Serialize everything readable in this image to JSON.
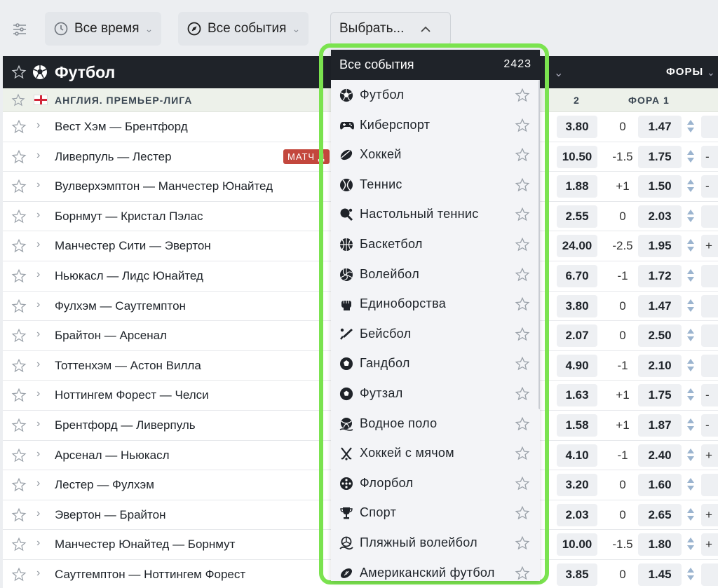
{
  "filters": {
    "time_label": "Все время",
    "events_label": "Все события",
    "select_label": "Выбрать..."
  },
  "sport_header": {
    "title": "Футбол",
    "fory_label": "ФОРЫ"
  },
  "league": {
    "name": "АНГЛИЯ. ПРЕМЬЕР-ЛИГА",
    "col_2": "2",
    "col_fora1": "ФОРА 1"
  },
  "matches": [
    {
      "teams": "Вест Хэм — Брентфорд",
      "odd2": "3.80",
      "handicap": "0",
      "fora1": "1.47",
      "edge": ""
    },
    {
      "teams": "Ливерпуль — Лестер",
      "badge": "МАТЧ Д",
      "odd2": "10.50",
      "handicap": "-1.5",
      "fora1": "1.75",
      "edge": "-"
    },
    {
      "teams": "Вулверхэмптон — Манчестер Юнайтед",
      "odd2": "1.88",
      "handicap": "+1",
      "fora1": "1.50",
      "edge": "-"
    },
    {
      "teams": "Борнмут — Кристал Пэлас",
      "odd2": "2.55",
      "handicap": "0",
      "fora1": "2.03",
      "edge": ""
    },
    {
      "teams": "Манчестер Сити — Эвертон",
      "odd2": "24.00",
      "handicap": "-2.5",
      "fora1": "1.95",
      "edge": "+"
    },
    {
      "teams": "Ньюкасл — Лидс Юнайтед",
      "odd2": "6.70",
      "handicap": "-1",
      "fora1": "1.72",
      "edge": ""
    },
    {
      "teams": "Фулхэм — Саутгемптон",
      "odd2": "3.80",
      "handicap": "0",
      "fora1": "1.47",
      "edge": ""
    },
    {
      "teams": "Брайтон — Арсенал",
      "odd2": "2.07",
      "handicap": "0",
      "fora1": "2.50",
      "edge": ""
    },
    {
      "teams": "Тоттенхэм — Астон Вилла",
      "odd2": "4.90",
      "handicap": "-1",
      "fora1": "2.10",
      "edge": ""
    },
    {
      "teams": "Ноттингем Форест — Челси",
      "odd2": "1.63",
      "handicap": "+1",
      "fora1": "1.75",
      "edge": "-"
    },
    {
      "teams": "Брентфорд — Ливерпуль",
      "odd2": "1.58",
      "handicap": "+1",
      "fora1": "1.87",
      "edge": "-"
    },
    {
      "teams": "Арсенал — Ньюкасл",
      "odd2": "4.10",
      "handicap": "-1",
      "fora1": "2.40",
      "edge": "+"
    },
    {
      "teams": "Лестер — Фулхэм",
      "odd2": "3.20",
      "handicap": "0",
      "fora1": "1.60",
      "edge": ""
    },
    {
      "teams": "Эвертон — Брайтон",
      "odd2": "2.03",
      "handicap": "0",
      "fora1": "2.65",
      "edge": "+"
    },
    {
      "teams": "Манчестер Юнайтед — Борнмут",
      "odd2": "10.00",
      "handicap": "-1.5",
      "fora1": "1.80",
      "edge": "+"
    },
    {
      "teams": "Саутгемптон — Ноттингем Форест",
      "odd2": "3.85",
      "handicap": "0",
      "fora1": "1.45",
      "edge": ""
    }
  ],
  "dropdown": {
    "header_label": "Все события",
    "header_count": "2423",
    "items": [
      {
        "label": "Футбол",
        "icon": "soccer-ball-icon"
      },
      {
        "label": "Киберспорт",
        "icon": "gamepad-icon"
      },
      {
        "label": "Хоккей",
        "icon": "hockey-puck-icon"
      },
      {
        "label": "Теннис",
        "icon": "tennis-ball-icon"
      },
      {
        "label": "Настольный теннис",
        "icon": "table-tennis-icon"
      },
      {
        "label": "Баскетбол",
        "icon": "basketball-icon"
      },
      {
        "label": "Волейбол",
        "icon": "volleyball-icon"
      },
      {
        "label": "Единоборства",
        "icon": "fist-icon"
      },
      {
        "label": "Бейсбол",
        "icon": "baseball-bat-icon"
      },
      {
        "label": "Гандбол",
        "icon": "handball-icon"
      },
      {
        "label": "Футзал",
        "icon": "futsal-ball-icon"
      },
      {
        "label": "Водное поло",
        "icon": "water-polo-icon"
      },
      {
        "label": "Хоккей с мячом",
        "icon": "bandy-sticks-icon"
      },
      {
        "label": "Флорбол",
        "icon": "floorball-icon"
      },
      {
        "label": "Спорт",
        "icon": "trophy-icon"
      },
      {
        "label": "Пляжный волейбол",
        "icon": "beach-volleyball-icon"
      },
      {
        "label": "Американский футбол",
        "icon": "american-football-icon"
      }
    ]
  },
  "colors": {
    "highlight_outline": "#7be34f",
    "dark_header": "#1f2329",
    "badge_red": "#c3473d"
  }
}
